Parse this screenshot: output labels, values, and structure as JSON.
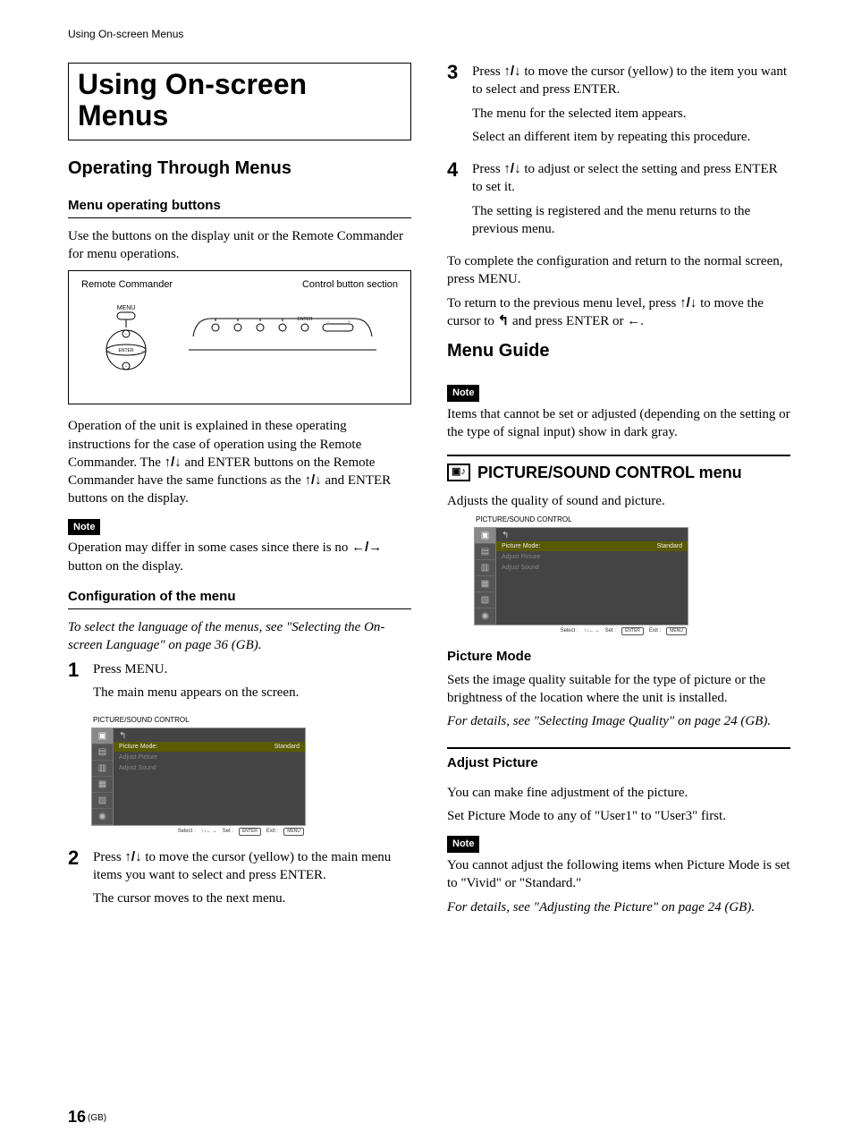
{
  "header": {
    "running": "Using On-screen Menus"
  },
  "title": "Using On-screen Menus",
  "left": {
    "section1": "Operating Through Menus",
    "sub1": "Menu operating buttons",
    "p1": "Use the buttons on the display unit or the Remote Commander for menu operations.",
    "remote": {
      "label_remote": "Remote Commander",
      "label_control": "Control button section",
      "menu": "MENU",
      "enter": "ENTER"
    },
    "p2a": "Operation of the unit is explained in these operating instructions for the case of operation using the Remote Commander. The ",
    "p2b": " and ENTER buttons on the Remote Commander have the same functions as the ",
    "p2c": " and ENTER buttons on the display.",
    "note1_label": "Note",
    "note1a": "Operation may differ in some cases since there is no ",
    "note1b": " button on the display.",
    "sub2": "Configuration of the menu",
    "sub2_note": "To select the language of the menus, see \"Selecting the On-screen Language\" on page 36 (GB).",
    "step1_num": "1",
    "step1a": "Press MENU.",
    "step1b": "The main menu appears on the screen.",
    "step2_num": "2",
    "step2a": "Press ",
    "step2b": " to move the cursor (yellow) to the main menu items you want to select and press ENTER.",
    "step2c": "The cursor moves to the next menu."
  },
  "right": {
    "step3_num": "3",
    "step3a": "Press ",
    "step3b": " to move the cursor (yellow) to the item you want to select and press ENTER.",
    "step3c": "The menu for the selected item appears.",
    "step3d": "Select an different item by repeating this procedure.",
    "step4_num": "4",
    "step4a": "Press ",
    "step4b": " to adjust or select the setting and press ENTER to set it.",
    "step4c": "The setting is registered and the menu returns to the previous menu.",
    "pconf1": "To complete the configuration and return to the normal screen, press MENU.",
    "pconf2a": "To return to the previous menu level, press ",
    "pconf2b": " to move the cursor to ",
    "pconf2c": " and press ENTER or ",
    "pconf2d": ".",
    "section2": "Menu Guide",
    "note2_label": "Note",
    "note2": "Items that cannot be set or adjusted (depending on the setting or the type of signal input) show in dark gray.",
    "ps_head": "PICTURE/SOUND CONTROL menu",
    "ps_intro": "Adjusts the quality of sound and picture.",
    "pm_head": "Picture Mode",
    "pm_p1": "Sets the image quality suitable for the type of picture or the brightness of the location where the unit is installed.",
    "pm_p2": "For details, see \"Selecting Image Quality\" on page 24 (GB).",
    "ap_head": "Adjust Picture",
    "ap_p1": "You can make fine adjustment of the picture.",
    "ap_p2": "Set Picture Mode to any of \"User1\" to \"User3\" first.",
    "note3_label": "Note",
    "note3a": "You cannot adjust the following items when Picture Mode is set to \"Vivid\" or \"Standard.\"",
    "note3b": "For details, see \"Adjusting the Picture\" on page 24 (GB)."
  },
  "menu_ui": {
    "title": "PICTURE/SOUND CONTROL",
    "back": "↰",
    "row1_l": "Picture Mode:",
    "row1_r": "Standard",
    "row2": "Adjust Picture",
    "row3": "Adjust Sound",
    "footer_select": "Select :",
    "footer_arrows": "↑↓←→",
    "footer_set": "Set :",
    "footer_set_btn": "ENTER",
    "footer_exit": "Exit :",
    "footer_exit_btn": "MENU"
  },
  "arrows": {
    "ud": "↑/↓",
    "lr": "←/→",
    "back": "↰",
    "left": "←"
  },
  "footer": {
    "page": "16",
    "suffix": "(GB)"
  }
}
